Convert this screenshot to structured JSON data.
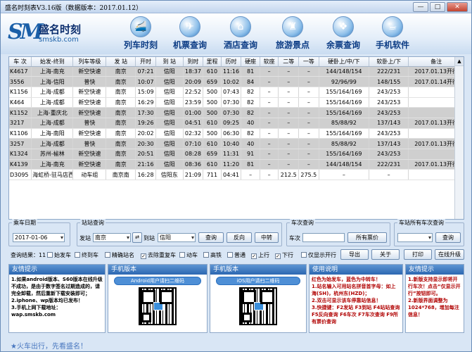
{
  "window": {
    "title": "盛名时刻表V3.16版（数据版本：2017.01.12）",
    "min": "—",
    "max": "□",
    "close": "✕"
  },
  "logo": {
    "mark": "SM",
    "name_cn": "盛名时刻",
    "name_en": "smskb.com"
  },
  "nav": [
    {
      "label": "列车时刻",
      "icon": "train-icon"
    },
    {
      "label": "机票查询",
      "icon": "airplane-icon"
    },
    {
      "label": "酒店查询",
      "icon": "hotel-icon"
    },
    {
      "label": "旅游景点",
      "icon": "tower-icon"
    },
    {
      "label": "余票查询",
      "icon": "windows-icon"
    },
    {
      "label": "手机软件",
      "icon": "java-cup-icon"
    }
  ],
  "table": {
    "headers": [
      "车 次",
      "始发-终到",
      "列车等级",
      "发 站",
      "开时",
      "到 站",
      "到时",
      "里程",
      "历时",
      "硬座",
      "软座",
      "二等",
      "一等",
      "硬卧上/中/下",
      "软卧上/下",
      "备注"
    ],
    "rows": [
      [
        "K4617",
        "上海-南充",
        "新空快速",
        "南京",
        "07:21",
        "信阳",
        "18:37",
        "610",
        "11:16",
        "81",
        "–",
        "–",
        "–",
        "144/148/154",
        "222/231",
        "2017.01.13开行"
      ],
      [
        "3556",
        "上海-信阳",
        "普快",
        "南京",
        "10:07",
        "信阳",
        "20:09",
        "659",
        "10:02",
        "84",
        "–",
        "–",
        "–",
        "92/96/99",
        "148/155",
        "2017.01.14开行"
      ],
      [
        "K1156",
        "上海-成都",
        "新空快速",
        "南京",
        "15:09",
        "信阳",
        "22:52",
        "500",
        "07:43",
        "82",
        "–",
        "–",
        "–",
        "155/164/169",
        "243/253",
        ""
      ],
      [
        "K464",
        "上海-成都",
        "新空快速",
        "南京",
        "16:29",
        "信阳",
        "23:59",
        "500",
        "07:30",
        "82",
        "–",
        "–",
        "–",
        "155/164/169",
        "243/253",
        ""
      ],
      [
        "K1152",
        "上海-重庆北",
        "新空快速",
        "南京",
        "17:30",
        "信阳",
        "01:00",
        "500",
        "07:30",
        "82",
        "–",
        "–",
        "–",
        "155/164/169",
        "243/253",
        ""
      ],
      [
        "3217",
        "上海-成都",
        "普快",
        "南京",
        "19:26",
        "信阳",
        "04:51",
        "610",
        "09:25",
        "40",
        "–",
        "–",
        "–",
        "85/88/92",
        "137/143",
        "2017.01.13开行"
      ],
      [
        "K1106",
        "上海-南阳",
        "新空快速",
        "南京",
        "20:02",
        "信阳",
        "02:32",
        "500",
        "06:30",
        "82",
        "–",
        "–",
        "–",
        "155/164/169",
        "243/253",
        ""
      ],
      [
        "3257",
        "上海-成都",
        "普快",
        "南京",
        "20:30",
        "信阳",
        "07:10",
        "610",
        "10:40",
        "40",
        "–",
        "–",
        "–",
        "85/88/92",
        "137/143",
        "2017.01.13开行"
      ],
      [
        "K1324",
        "苏州-榆林",
        "新空快速",
        "南京",
        "20:51",
        "信阳",
        "08:28",
        "659",
        "11:31",
        "91",
        "–",
        "–",
        "–",
        "155/164/169",
        "243/253",
        ""
      ],
      [
        "K4139",
        "上海-南充",
        "新空快速",
        "南京",
        "21:16",
        "信阳",
        "08:36",
        "610",
        "11:20",
        "81",
        "–",
        "–",
        "–",
        "144/148/154",
        "222/231",
        "2017.01.13开行"
      ],
      [
        "D3095",
        "海虹桥-驻马店西",
        "动车组",
        "南京南",
        "16:28",
        "信阳东",
        "21:09",
        "711",
        "04:41",
        "–",
        "–",
        "212.5",
        "275.5",
        "–",
        "–",
        ""
      ]
    ]
  },
  "controls": {
    "date_legend": "乘车日期",
    "date_value": "2017-01-06",
    "station_legend": "站站查询",
    "from_label": "发站",
    "from_value": "南京",
    "to_label": "到站",
    "to_value": "信阳",
    "query": "查询",
    "reverse": "反向",
    "transfer": "中转",
    "train_legend": "车次查询",
    "train_label": "车次",
    "train_value": "",
    "all_tickets": "所有票价",
    "station_all_legend": "车站所有车次查询",
    "station_all_value": "",
    "station_all_query": "查询",
    "result_count": "查询结果：11",
    "filters": [
      {
        "label": "始发车",
        "checked": false
      },
      {
        "label": "终到车",
        "checked": false
      },
      {
        "label": "精确站名",
        "checked": false
      },
      {
        "label": "去除重复车",
        "checked": true
      },
      {
        "label": "动车",
        "checked": false
      },
      {
        "label": "高铁",
        "checked": false
      },
      {
        "label": "普通",
        "checked": false
      },
      {
        "label": "上行",
        "checked": true
      },
      {
        "label": "下行",
        "checked": true
      },
      {
        "label": "仅显示开行",
        "checked": false
      }
    ],
    "export": "导出",
    "about": "关于",
    "print": "打印",
    "online_upgrade": "在线升级"
  },
  "panels": {
    "tip": {
      "title": "友情提示",
      "body": "1.如果android版本、S60版本在线升级不成功，是由于数字签名过期造成的，请完全卸载，然后重新下载安装即可；\n2.iphone、wp版本均已发布！\n3.手机上网下载地址：wap.smskb.com"
    },
    "mobile1": {
      "title": "手机版本",
      "badge": "Android用户请扫二维码"
    },
    "mobile2": {
      "title": "手机版本",
      "badge": "iOS用户请扫二维码"
    },
    "usage": {
      "title": "使用说明",
      "body": "红色为始发车，蓝色为中转车！\n1.站名输入可用站名拼音首字母：如上海(SH)，杭州东(HZD)；\n2.双击可显示该车停靠站信息！\n3.快捷键：F2发站 F3到站 F4站站查询 F5反向查询 F6车次 F7车次查询 F9所有票价查询"
    },
    "tip2": {
      "title": "友情提示",
      "body": "1.新版支持显示即将开行车次！点击“仅显示开行”按钮即可。\n2.新版界面调整为1024*768，增加每注信息！"
    }
  },
  "footer": {
    "text": "★火车出行，先看盛名！"
  }
}
